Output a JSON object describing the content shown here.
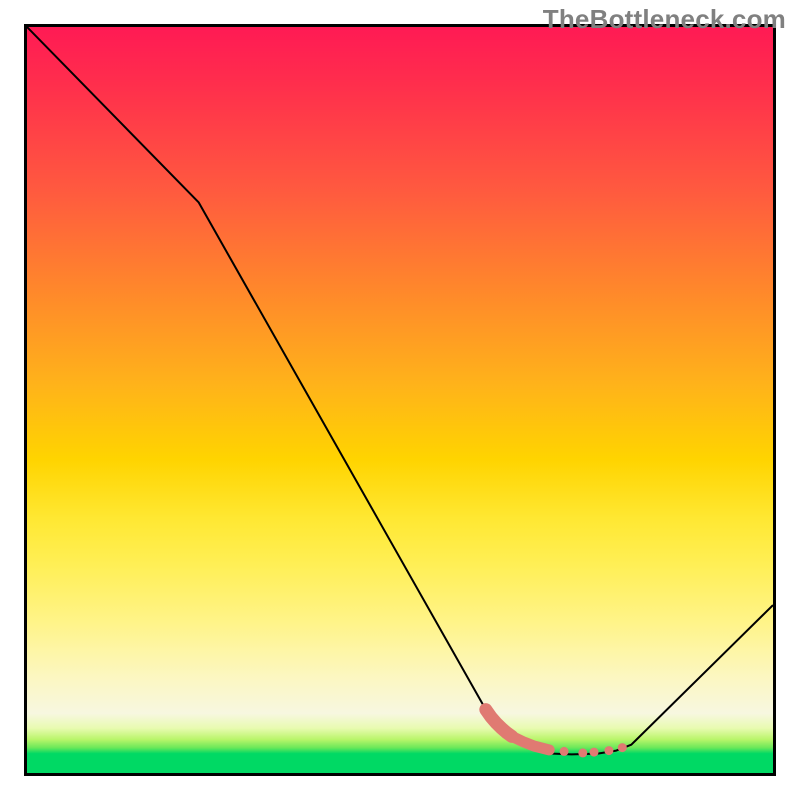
{
  "watermark_text": "TheBottleneck.com",
  "chart_data": {
    "type": "line",
    "title": "",
    "xlabel": "",
    "ylabel": "",
    "x_range": [
      0,
      100
    ],
    "y_range": [
      0,
      100
    ],
    "series": [
      {
        "name": "curve",
        "x": [
          0,
          23,
          61.5,
          66,
          68.5,
          70.5,
          73,
          76.5,
          79,
          81,
          100
        ],
        "y": [
          100,
          76.5,
          8.5,
          4.2,
          3.0,
          2.6,
          2.5,
          2.6,
          3.0,
          3.8,
          22.5
        ],
        "color": "#000000",
        "width": 2
      },
      {
        "name": "valley-dots",
        "x": [
          61.5,
          62.2,
          62.9,
          63.6,
          64.3,
          65.0,
          66.5,
          68.0,
          70.0,
          72.0,
          74.5,
          76.0,
          78.0,
          79.8
        ],
        "y": [
          8.5,
          7.5,
          6.7,
          6.0,
          5.4,
          4.9,
          4.2,
          3.6,
          3.1,
          2.9,
          2.7,
          2.8,
          3.0,
          3.4
        ],
        "color": "#e07a72",
        "dot_radius": 4.5
      }
    ],
    "gradient_stops": [
      {
        "pct": 0,
        "color": "#ff1a54"
      },
      {
        "pct": 36,
        "color": "#ff8a2a"
      },
      {
        "pct": 58,
        "color": "#ffd400"
      },
      {
        "pct": 87,
        "color": "#fcf7c0"
      },
      {
        "pct": 97,
        "color": "#00d964"
      }
    ]
  }
}
